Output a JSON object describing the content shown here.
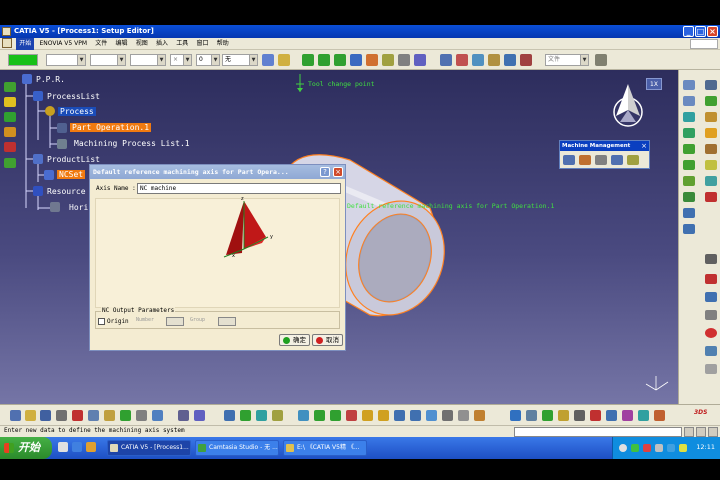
{
  "window": {
    "title": "CATIA V5 - [Process1: Setup Editor]",
    "controls": {
      "minimize": "_",
      "maximize": "□",
      "close": "×"
    }
  },
  "menu": {
    "items": [
      "开始",
      "ENOVIA V5 VPM",
      "文件",
      "编辑",
      "视图",
      "插入",
      "工具",
      "窗口",
      "帮助"
    ]
  },
  "toolbar": {
    "color_combo": "",
    "thickness_combo": "0",
    "layer_combo": "无",
    "file_combo": "文件"
  },
  "viewport": {
    "tool_change_label": "Tool change point",
    "machining_axis_label": "Default reference machining axis for Part Operation.1",
    "compass_label": "1X"
  },
  "tree": {
    "root": "P.P.R.",
    "process_list": "ProcessList",
    "process": "Process",
    "part_operation": "Part Operation.1",
    "machining_process_list": "Machining Process List.1",
    "product_list": "ProductList",
    "nc_setup": "NCSet",
    "resource": "Resource",
    "hori": "Hori"
  },
  "dialog": {
    "title": "Default reference machining axis for Part Opera...",
    "axis_name_label": "Axis Name :",
    "axis_name_value": "NC machine",
    "axis_x": "x",
    "axis_y": "y",
    "axis_z": "z",
    "nc_group_title": "NC Output Parameters",
    "origin_label": "Origin",
    "number_label": "Number",
    "group_label": "Group",
    "ok_label": "确定",
    "cancel_label": "取消"
  },
  "machine_panel": {
    "title": "Machine Management"
  },
  "status": {
    "text": "Enter new data to define the machining axis system"
  },
  "taskbar": {
    "start": "开始",
    "tasks": [
      "CATIA V5 - [Process1...",
      "Camtasia Studio - 无 ...",
      "E:\\ 《CATIA V5精 《..."
    ],
    "clock": "12:11"
  },
  "colors": {
    "orange_highlight": "#f07a10",
    "blue_highlight": "#1a4cb8",
    "viewport_top": "#2d2d5d",
    "viewport_bottom": "#7575a6",
    "dialog_bg": "#f4ecd2",
    "taskbar": "#1d4fc4"
  }
}
